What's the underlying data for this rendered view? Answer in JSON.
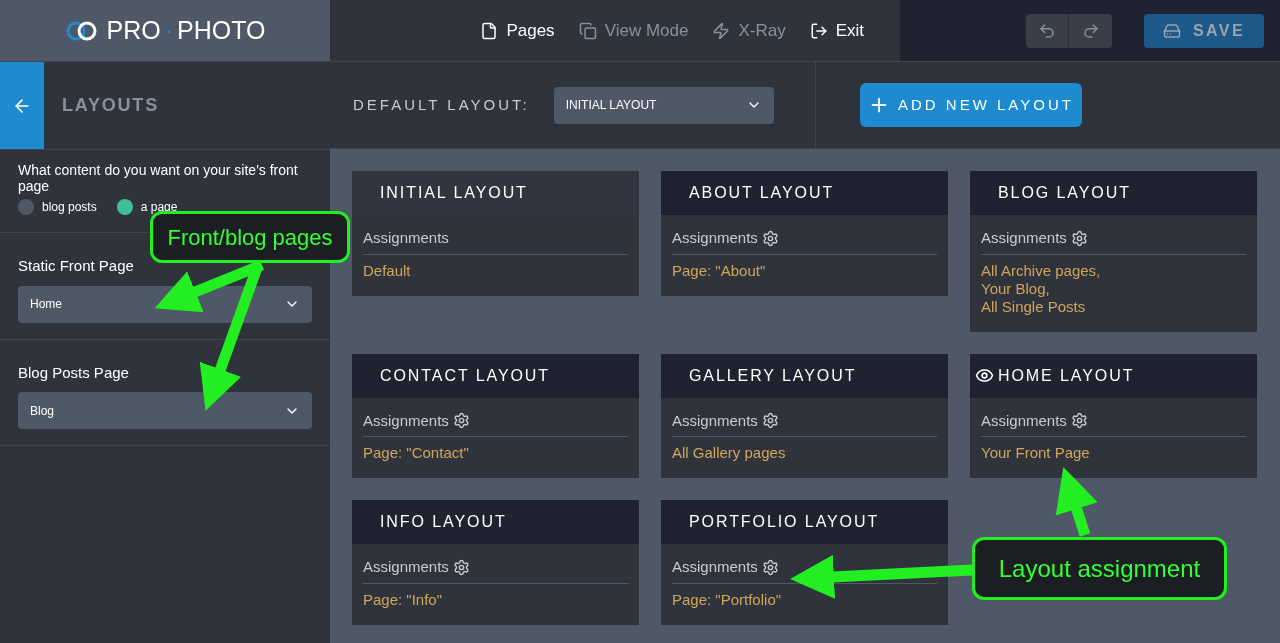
{
  "logo": {
    "left": "PRO",
    "separator": "·",
    "right": "PHOTO"
  },
  "nav": [
    {
      "label": "Pages",
      "disabled": false
    },
    {
      "label": "View Mode",
      "disabled": true
    },
    {
      "label": "X-Ray",
      "disabled": true
    },
    {
      "label": "Exit",
      "disabled": false
    }
  ],
  "save_button": {
    "label": "SAVE",
    "disabled": true
  },
  "sidebar": {
    "title": "LAYOUTS",
    "front_page_content": {
      "label": "What content do you want on your site's front page",
      "options": [
        {
          "label": "blog posts",
          "selected": false
        },
        {
          "label": "a page",
          "selected": true
        }
      ]
    },
    "selects": [
      {
        "label": "Static Front Page",
        "value": "Home"
      },
      {
        "label": "Blog Posts Page",
        "value": "Blog"
      }
    ]
  },
  "toolbar": {
    "default_layout_label": "DEFAULT LAYOUT:",
    "default_layout_value": "INITIAL LAYOUT",
    "add_button": "ADD NEW LAYOUT"
  },
  "layouts": [
    {
      "title": "INITIAL LAYOUT",
      "selected": true,
      "viewing": false,
      "configurable": false,
      "assignments_label": "Assignments",
      "assignments": [
        "Default"
      ]
    },
    {
      "title": "ABOUT LAYOUT",
      "selected": false,
      "viewing": false,
      "configurable": true,
      "assignments_label": "Assignments",
      "assignments": [
        "Page: \"About\""
      ]
    },
    {
      "title": "BLOG LAYOUT",
      "selected": false,
      "viewing": false,
      "configurable": true,
      "assignments_label": "Assignments",
      "assignments": [
        "All Archive pages,",
        "Your Blog,",
        "All Single Posts"
      ]
    },
    {
      "title": "CONTACT LAYOUT",
      "selected": false,
      "viewing": false,
      "configurable": true,
      "assignments_label": "Assignments",
      "assignments": [
        "Page: \"Contact\""
      ]
    },
    {
      "title": "GALLERY LAYOUT",
      "selected": false,
      "viewing": false,
      "configurable": true,
      "assignments_label": "Assignments",
      "assignments": [
        "All Gallery pages"
      ]
    },
    {
      "title": "HOME LAYOUT",
      "selected": false,
      "viewing": true,
      "configurable": true,
      "assignments_label": "Assignments",
      "assignments": [
        "Your Front Page"
      ]
    },
    {
      "title": "INFO LAYOUT",
      "selected": false,
      "viewing": false,
      "configurable": true,
      "assignments_label": "Assignments",
      "assignments": [
        "Page: \"Info\""
      ]
    },
    {
      "title": "PORTFOLIO LAYOUT",
      "selected": false,
      "viewing": false,
      "configurable": true,
      "assignments_label": "Assignments",
      "assignments": [
        "Page: \"Portfolio\""
      ]
    }
  ],
  "annotations": [
    {
      "text": "Front/blog pages"
    },
    {
      "text": "Layout assignment"
    }
  ]
}
